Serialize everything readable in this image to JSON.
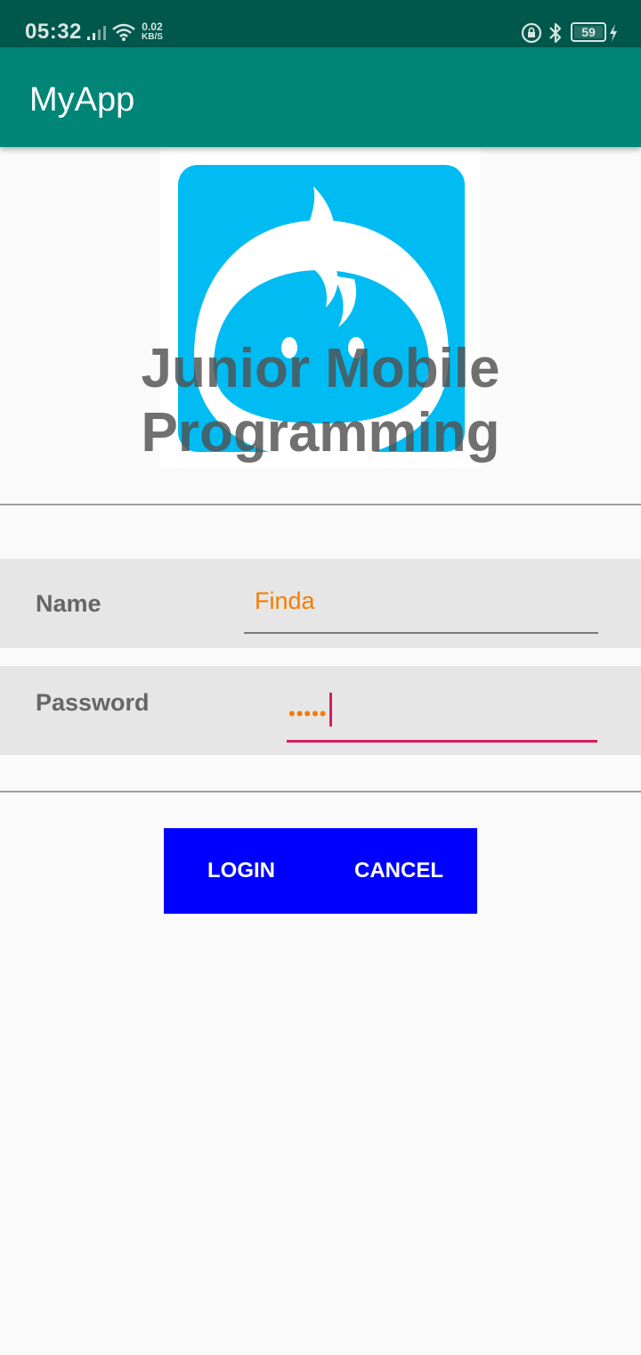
{
  "status_bar": {
    "time": "05:32",
    "net_speed_value": "0.02",
    "net_speed_unit": "KB/S",
    "battery": "59"
  },
  "app_bar": {
    "title": "MyApp"
  },
  "header": {
    "line1": "Junior Mobile",
    "line2": "Programming"
  },
  "form": {
    "name_label": "Name",
    "name_value": "Finda",
    "password_label": "Password",
    "password_value": "•••••"
  },
  "buttons": {
    "login": "LOGIN",
    "cancel": "CANCEL"
  },
  "colors": {
    "status_bar": "#00574b",
    "app_bar": "#008577",
    "logo_blue": "#00bcf2",
    "input_text": "#f57c00",
    "focus_accent": "#d81b60",
    "button_bar": "#0000ff"
  },
  "icons": [
    "signal-icon",
    "wifi-icon",
    "lock-rotation-icon",
    "bluetooth-icon",
    "battery-icon",
    "charging-icon",
    "logo-icon"
  ]
}
